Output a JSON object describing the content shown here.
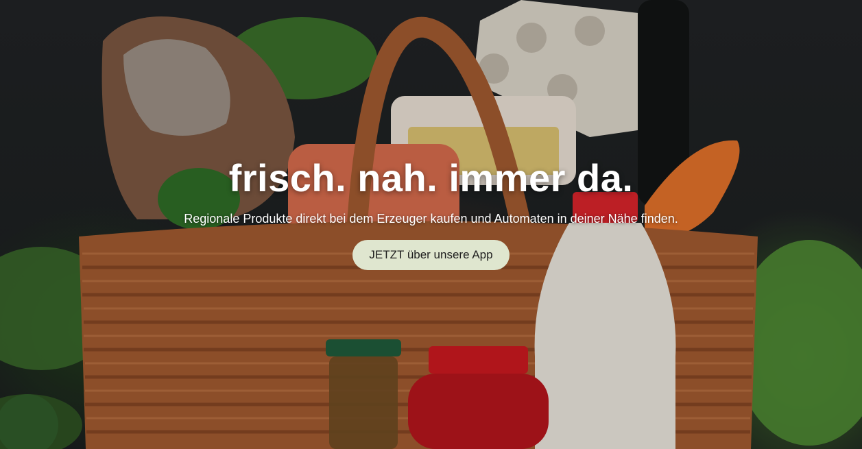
{
  "hero": {
    "headline": "frisch. nah. immer da.",
    "subline": "Regionale Produkte direkt bei dem Erzeuger kaufen und Automaten in deiner Nähe finden.",
    "cta_label": "JETZT über unsere App"
  },
  "colors": {
    "cta_background": "#dfe6cf",
    "cta_text": "#1e1e1e",
    "headline_text": "#ffffff"
  },
  "icons": {
    "background_image": "grocery-basket-photo"
  }
}
